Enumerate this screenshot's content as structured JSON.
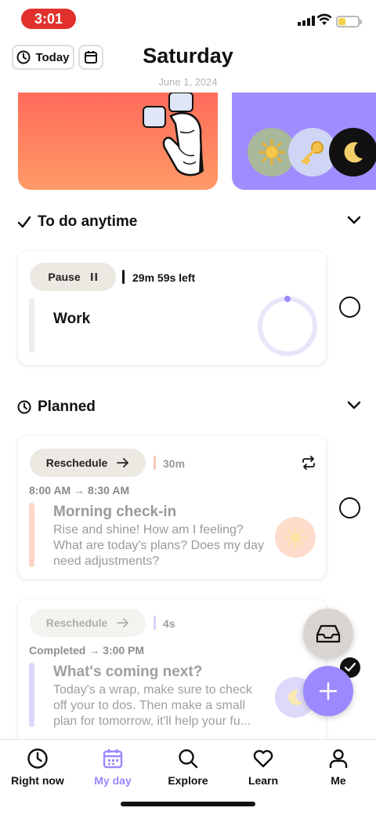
{
  "status_bar": {
    "time": "3:01"
  },
  "header": {
    "today_label": "Today",
    "title": "Saturday",
    "subtitle": "June 1, 2024"
  },
  "sections": {
    "anytime": {
      "title": "To do anytime"
    },
    "planned": {
      "title": "Planned"
    }
  },
  "work_card": {
    "pause_label": "Pause",
    "time_left": "29m 59s left",
    "title": "Work"
  },
  "checkin_card": {
    "reschedule_label": "Reschedule",
    "duration": "30m",
    "time_range": "8:00 AM → 8:30 AM",
    "title": "Morning check-in",
    "description": "Rise and shine! How am I feeling? What are today's plans? Does my day need adjustments?"
  },
  "next_card": {
    "reschedule_label": "Reschedule",
    "duration": "4s",
    "time_range": "Completed → 3:00 PM",
    "title": "What's coming next?",
    "description": "Today's a wrap, make sure to check off your to dos. Then make a small plan for tomorrow, it'll help your fu..."
  },
  "tabs": [
    {
      "label": "Right now",
      "icon": "clock-icon"
    },
    {
      "label": "My day",
      "icon": "calendar-icon"
    },
    {
      "label": "Explore",
      "icon": "search-icon"
    },
    {
      "label": "Learn",
      "icon": "heart-icon"
    },
    {
      "label": "Me",
      "icon": "person-icon"
    }
  ],
  "colors": {
    "accent": "#9c88ff",
    "status_pill": "#e2312c",
    "orange_banner": "#ff7a5e",
    "purple_banner": "#a08cff"
  }
}
